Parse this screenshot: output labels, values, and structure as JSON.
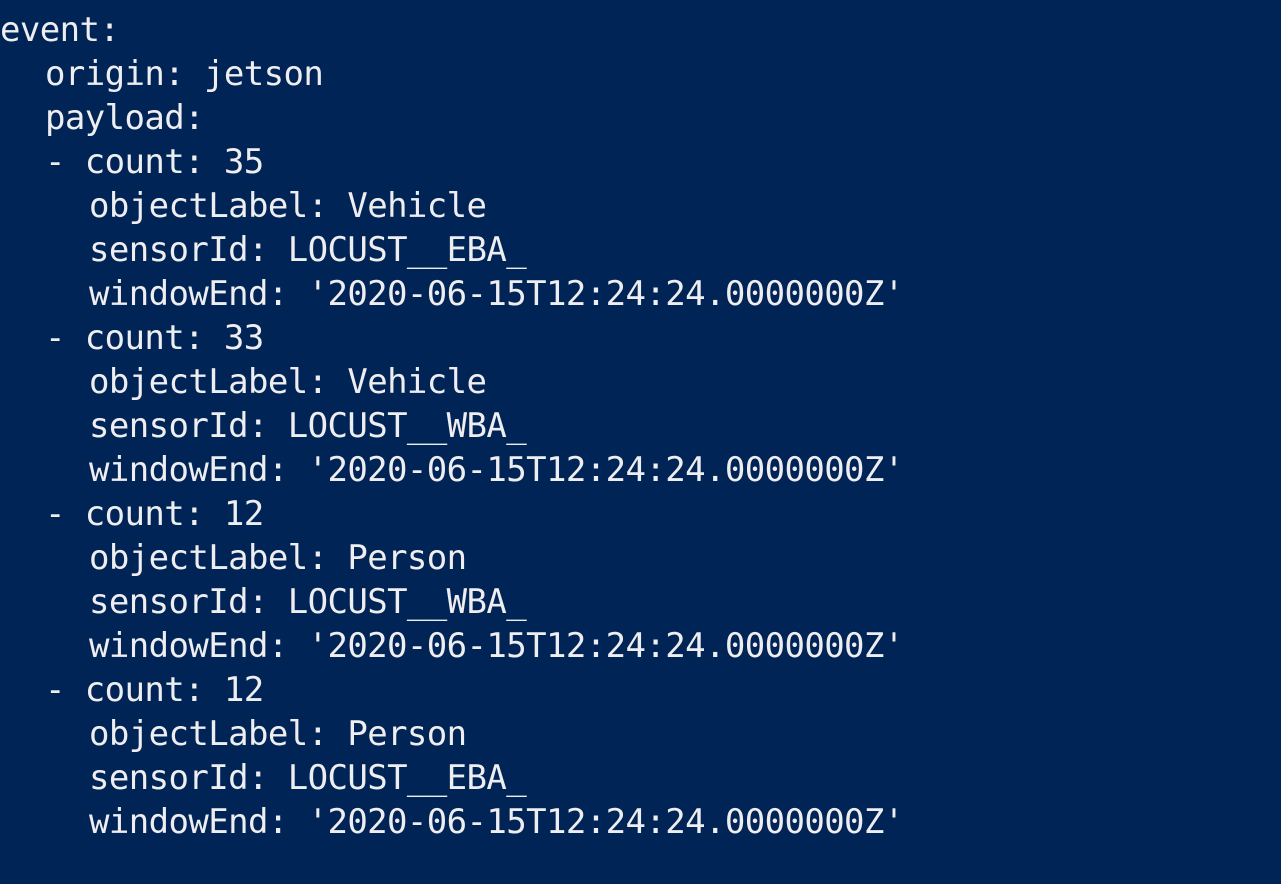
{
  "terminal": {
    "background": "#012456",
    "foreground": "#eeedf0",
    "root_key": "event",
    "origin": {
      "key": "origin",
      "value": "jetson"
    },
    "payload_key": "payload",
    "entries": [
      {
        "count": {
          "key": "count",
          "value": "35"
        },
        "objectLabel": {
          "key": "objectLabel",
          "value": "Vehicle"
        },
        "sensorId": {
          "key": "sensorId",
          "value": "LOCUST__EBA_"
        },
        "windowEnd": {
          "key": "windowEnd",
          "value": "'2020-06-15T12:24:24.0000000Z'"
        }
      },
      {
        "count": {
          "key": "count",
          "value": "33"
        },
        "objectLabel": {
          "key": "objectLabel",
          "value": "Vehicle"
        },
        "sensorId": {
          "key": "sensorId",
          "value": "LOCUST__WBA_"
        },
        "windowEnd": {
          "key": "windowEnd",
          "value": "'2020-06-15T12:24:24.0000000Z'"
        }
      },
      {
        "count": {
          "key": "count",
          "value": "12"
        },
        "objectLabel": {
          "key": "objectLabel",
          "value": "Person"
        },
        "sensorId": {
          "key": "sensorId",
          "value": "LOCUST__WBA_"
        },
        "windowEnd": {
          "key": "windowEnd",
          "value": "'2020-06-15T12:24:24.0000000Z'"
        }
      },
      {
        "count": {
          "key": "count",
          "value": "12"
        },
        "objectLabel": {
          "key": "objectLabel",
          "value": "Person"
        },
        "sensorId": {
          "key": "sensorId",
          "value": "LOCUST__EBA_"
        },
        "windowEnd": {
          "key": "windowEnd",
          "value": "'2020-06-15T12:24:24.0000000Z'"
        }
      }
    ]
  }
}
